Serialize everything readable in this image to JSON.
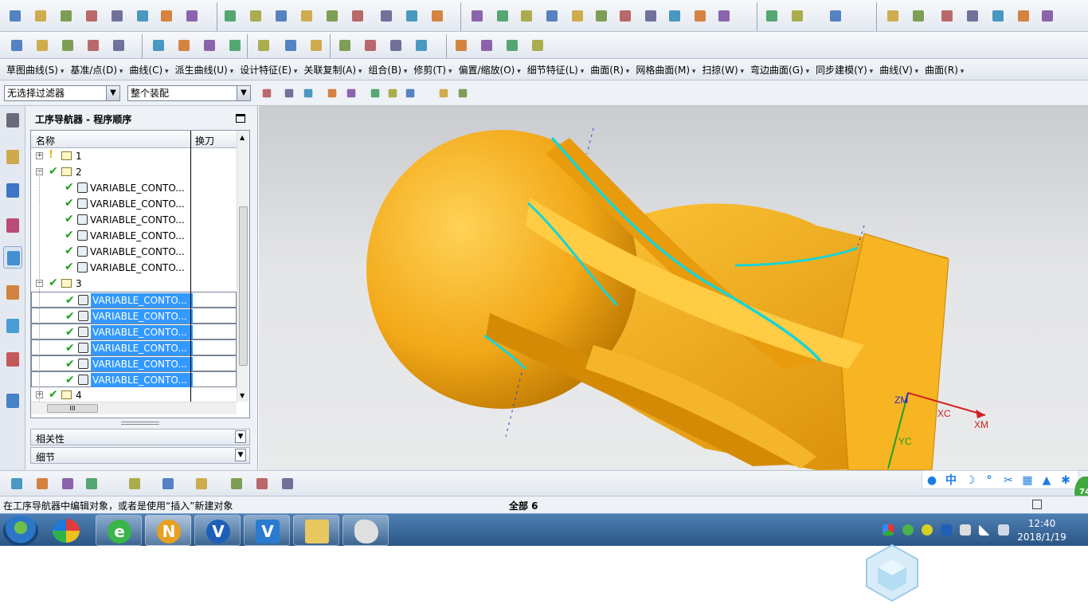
{
  "menu": [
    "草图曲线(S)",
    "基准/点(D)",
    "曲线(C)",
    "派生曲线(U)",
    "设计特征(E)",
    "关联复制(A)",
    "组合(B)",
    "修剪(T)",
    "偏置/缩放(O)",
    "细节特征(L)",
    "曲面(R)",
    "网格曲面(M)",
    "扫掠(W)",
    "弯边曲面(G)",
    "同步建模(Y)",
    "曲线(V)",
    "曲面(R)"
  ],
  "filters": {
    "type_filter": "无选择过滤器",
    "scope_filter": "整个装配"
  },
  "navigator": {
    "title": "工序导航器 - 程序顺序",
    "columns": [
      "名称",
      "换刀"
    ],
    "rows": [
      {
        "indent": 0,
        "expander": "+",
        "status": "warn",
        "label": "1",
        "selected": false
      },
      {
        "indent": 0,
        "expander": "-",
        "status": "ok",
        "label": "2",
        "selected": false
      },
      {
        "indent": 1,
        "expander": "",
        "status": "ok",
        "label": "VARIABLE_CONTO...",
        "selected": false
      },
      {
        "indent": 1,
        "expander": "",
        "status": "ok",
        "label": "VARIABLE_CONTO...",
        "selected": false
      },
      {
        "indent": 1,
        "expander": "",
        "status": "ok",
        "label": "VARIABLE_CONTO...",
        "selected": false
      },
      {
        "indent": 1,
        "expander": "",
        "status": "ok",
        "label": "VARIABLE_CONTO...",
        "selected": false
      },
      {
        "indent": 1,
        "expander": "",
        "status": "ok",
        "label": "VARIABLE_CONTO...",
        "selected": false
      },
      {
        "indent": 1,
        "expander": "",
        "status": "ok",
        "label": "VARIABLE_CONTO...",
        "selected": false
      },
      {
        "indent": 0,
        "expander": "-",
        "status": "ok",
        "label": "3",
        "selected": false
      },
      {
        "indent": 1,
        "expander": "",
        "status": "ok",
        "label": "VARIABLE_CONTO...",
        "selected": true
      },
      {
        "indent": 1,
        "expander": "",
        "status": "ok",
        "label": "VARIABLE_CONTO...",
        "selected": true
      },
      {
        "indent": 1,
        "expander": "",
        "status": "ok",
        "label": "VARIABLE_CONTO...",
        "selected": true
      },
      {
        "indent": 1,
        "expander": "",
        "status": "ok",
        "label": "VARIABLE_CONTO...",
        "selected": true
      },
      {
        "indent": 1,
        "expander": "",
        "status": "ok",
        "label": "VARIABLE_CONTO...",
        "selected": true
      },
      {
        "indent": 1,
        "expander": "",
        "status": "ok",
        "label": "VARIABLE_CONTO...",
        "selected": true
      },
      {
        "indent": 0,
        "expander": "+",
        "status": "ok",
        "label": "4",
        "selected": false
      }
    ],
    "hscroll_thumb": "III",
    "panels": [
      "相关性",
      "细节"
    ]
  },
  "viewport": {
    "axis_labels": {
      "zm": "ZM",
      "xc": "XC",
      "xm": "XM",
      "yc": "YC"
    },
    "colors": {
      "part": "#f2a818",
      "toolpath": "#19d4d4",
      "background": "#e4e5e7"
    }
  },
  "ime": {
    "mode": "中"
  },
  "status": {
    "message": "在工序导航器中编辑对象，或者是使用“插入”新建对象",
    "selection": "全部 6"
  },
  "badge": "74",
  "clock": {
    "time": "12:40",
    "date": "2018/1/19"
  }
}
